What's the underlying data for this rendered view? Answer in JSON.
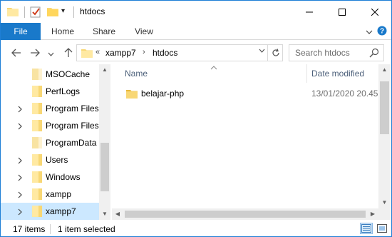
{
  "window": {
    "title": "htdocs",
    "quick_access_dropdown": "▾",
    "minimize_icon": "minimize-icon",
    "maximize_icon": "maximize-icon",
    "close_icon": "close-icon"
  },
  "ribbon": {
    "tabs": [
      {
        "label": "File"
      },
      {
        "label": "Home"
      },
      {
        "label": "Share"
      },
      {
        "label": "View"
      }
    ],
    "accent": "#1979ca"
  },
  "address": {
    "overflow": "«",
    "crumbs": [
      "xampp7",
      "htdocs"
    ],
    "separator": "›"
  },
  "search": {
    "placeholder": "Search htdocs"
  },
  "nav": {
    "items": [
      {
        "label": "MSOCache",
        "expandable": false
      },
      {
        "label": "PerfLogs",
        "expandable": false
      },
      {
        "label": "Program Files",
        "expandable": true
      },
      {
        "label": "Program Files",
        "expandable": true
      },
      {
        "label": "ProgramData",
        "expandable": false
      },
      {
        "label": "Users",
        "expandable": true
      },
      {
        "label": "Windows",
        "expandable": true
      },
      {
        "label": "xampp",
        "expandable": true
      },
      {
        "label": "xampp7",
        "expandable": true,
        "selected": true
      }
    ]
  },
  "content": {
    "columns": {
      "name": "Name",
      "date_modified": "Date modified"
    },
    "files": [
      {
        "name": "belajar-php",
        "date_modified": "13/01/2020 20.45",
        "type": "folder"
      }
    ]
  },
  "status": {
    "item_count": "17 items",
    "selection": "1 item selected"
  }
}
